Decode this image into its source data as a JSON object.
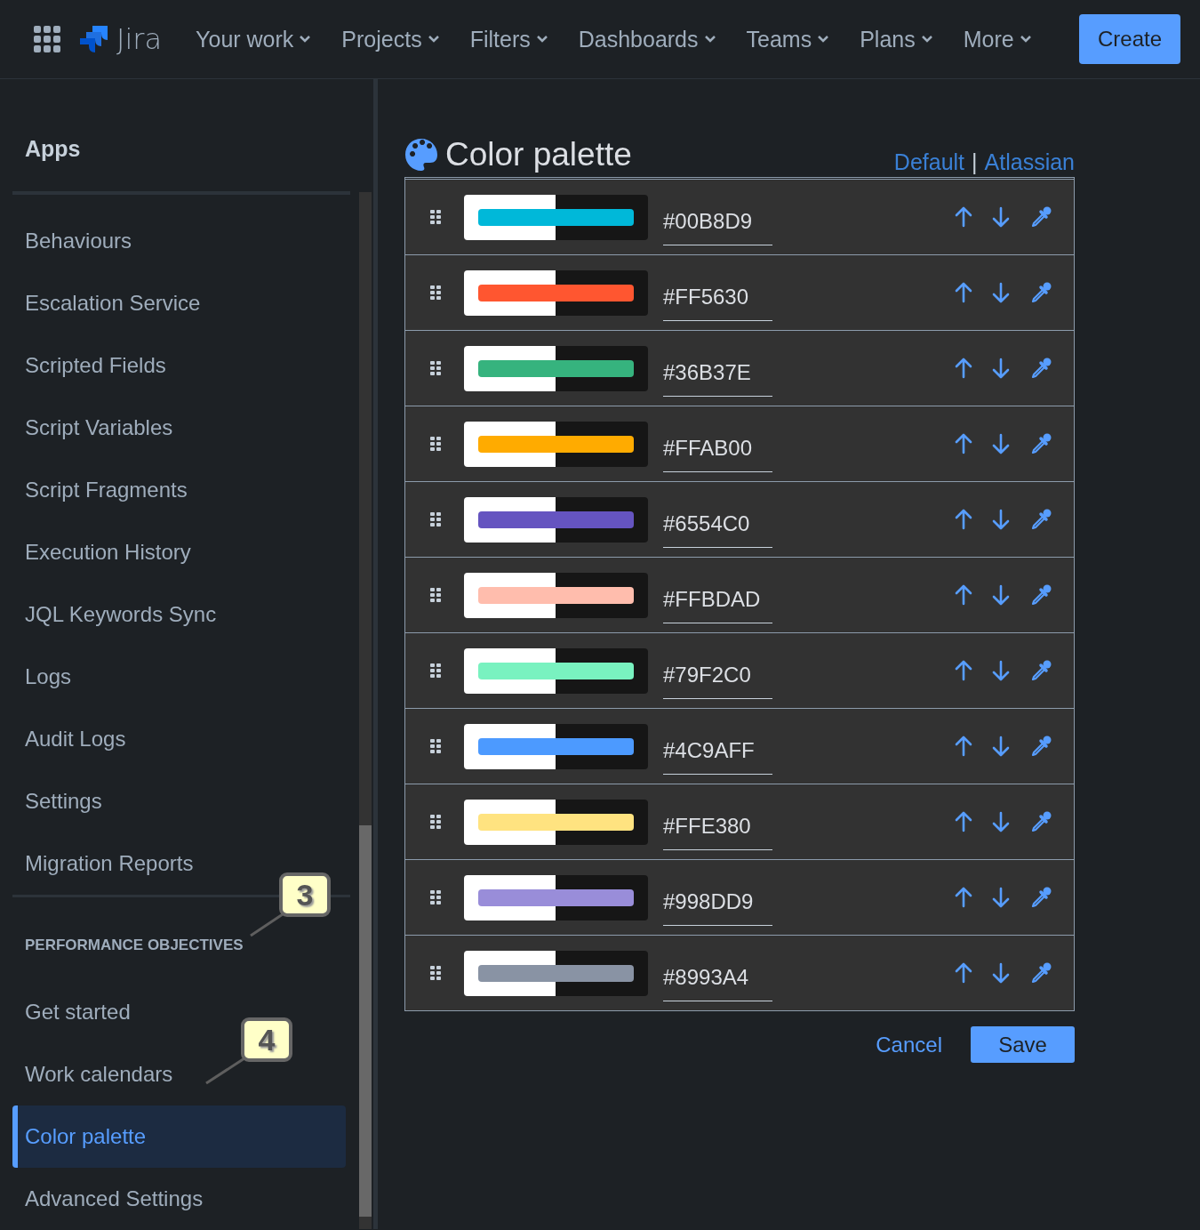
{
  "nav": {
    "product": "Jira",
    "items": [
      {
        "label": "Your work"
      },
      {
        "label": "Projects"
      },
      {
        "label": "Filters"
      },
      {
        "label": "Dashboards"
      },
      {
        "label": "Teams"
      },
      {
        "label": "Plans"
      },
      {
        "label": "More"
      }
    ],
    "create": "Create"
  },
  "sidebar": {
    "heading": "Apps",
    "items": [
      {
        "label": "Behaviours",
        "selected": false
      },
      {
        "label": "Escalation Service",
        "selected": false
      },
      {
        "label": "Scripted Fields",
        "selected": false
      },
      {
        "label": "Script Variables",
        "selected": false
      },
      {
        "label": "Script Fragments",
        "selected": false
      },
      {
        "label": "Execution History",
        "selected": false
      },
      {
        "label": "JQL Keywords Sync",
        "selected": false
      },
      {
        "label": "Logs",
        "selected": false
      },
      {
        "label": "Audit Logs",
        "selected": false
      },
      {
        "label": "Settings",
        "selected": false
      },
      {
        "label": "Migration Reports",
        "selected": false
      }
    ],
    "section": "PERFORMANCE OBJECTIVES",
    "section_items": [
      {
        "label": "Get started",
        "selected": false
      },
      {
        "label": "Work calendars",
        "selected": false
      },
      {
        "label": "Color palette",
        "selected": true
      },
      {
        "label": "Advanced Settings",
        "selected": false
      }
    ]
  },
  "callouts": [
    {
      "label": "3"
    },
    {
      "label": "4"
    }
  ],
  "palette": {
    "title": "Color palette",
    "presets": [
      "Default",
      "Atlassian"
    ],
    "separator": "|",
    "colors": [
      {
        "value": "#00B8D9",
        "color": "#00b8d9"
      },
      {
        "value": "#FF5630",
        "color": "#ff5630"
      },
      {
        "value": "#36B37E",
        "color": "#36b37e"
      },
      {
        "value": "#FFAB00",
        "color": "#ffab00"
      },
      {
        "value": "#6554C0",
        "color": "#6554c0"
      },
      {
        "value": "#FFBDAD",
        "color": "#ffbdad"
      },
      {
        "value": "#79F2C0",
        "color": "#79f2c0"
      },
      {
        "value": "#4C9AFF",
        "color": "#4c9aff"
      },
      {
        "value": "#FFE380",
        "color": "#ffe380"
      },
      {
        "value": "#998DD9",
        "color": "#998dd9"
      },
      {
        "value": "#8993A4",
        "color": "#8993a4"
      }
    ],
    "cancel": "Cancel",
    "save": "Save"
  }
}
